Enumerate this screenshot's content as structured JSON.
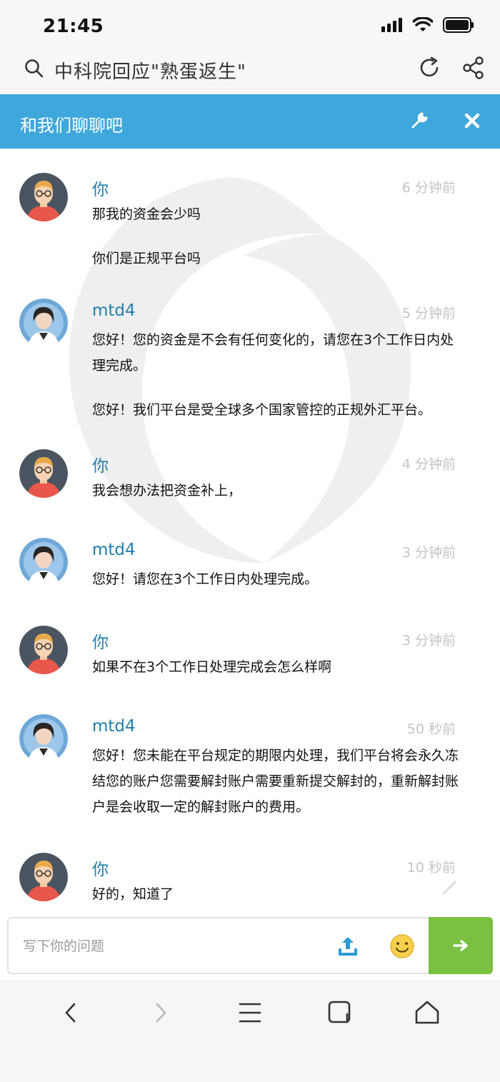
{
  "status": {
    "time": "21:45"
  },
  "browser": {
    "url_title": "中科院回应\"熟蛋返生\""
  },
  "chat": {
    "header_title": "和我们聊聊吧",
    "messages": [
      {
        "sender": "你",
        "time": "6 分钟前",
        "avatar": "user-avatar",
        "lines": [
          "那我的资金会少吗",
          "你们是正规平台吗"
        ]
      },
      {
        "sender": "mtd4",
        "time": "5 分钟前",
        "avatar": "agent-avatar",
        "lines": [
          "您好！您的资金是不会有任何变化的，请您在3个工作日内处理完成。",
          "您好！我们平台是受全球多个国家管控的正规外汇平台。"
        ]
      },
      {
        "sender": "你",
        "time": "4 分钟前",
        "avatar": "user-avatar",
        "lines": [
          "我会想办法把资金补上，"
        ]
      },
      {
        "sender": "mtd4",
        "time": "3 分钟前",
        "avatar": "agent-avatar",
        "lines": [
          "您好！请您在3个工作日内处理完成。"
        ]
      },
      {
        "sender": "你",
        "time": "3 分钟前",
        "avatar": "user-avatar",
        "lines": [
          "如果不在3个工作日处理完成会怎么样啊"
        ]
      },
      {
        "sender": "mtd4",
        "time": "50 秒前",
        "avatar": "agent-avatar",
        "lines": [
          "您好！您未能在平台规定的期限内处理，我们平台将会永久冻结您的账户您需要解封账户需要重新提交解封的，重新解封账户是会收取一定的解封账户的费用。"
        ]
      },
      {
        "sender": "你",
        "time": "10 秒前",
        "avatar": "user-avatar",
        "lines": [
          "好的，知道了"
        ]
      }
    ],
    "input": {
      "placeholder": "写下你的问题",
      "value": ""
    }
  },
  "colors": {
    "header": "#3ea7dc",
    "name": "#1e7fb0",
    "send": "#7ac143"
  }
}
